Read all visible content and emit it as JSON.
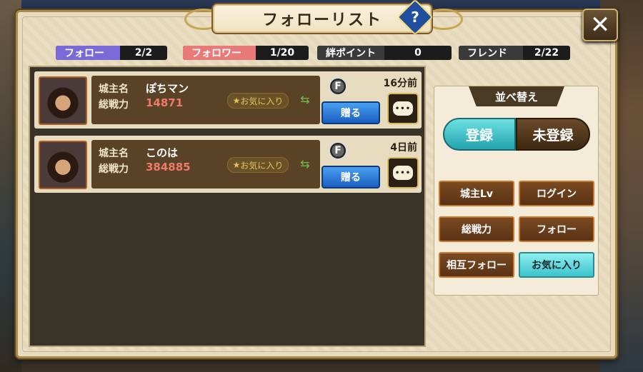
{
  "header": {
    "title": "フォローリスト",
    "help_label": "?",
    "close_label": "✕"
  },
  "stats": [
    {
      "label": "フォロー",
      "value": "2/2",
      "color": "#7a6ad8"
    },
    {
      "label": "フォロワー",
      "value": "1/20",
      "color": "#e87a7a"
    },
    {
      "label": "絆ポイント",
      "value": "0",
      "color": "#3a3a3a"
    },
    {
      "label": "フレンド",
      "value": "2/22",
      "color": "#3a3a3a"
    }
  ],
  "list": {
    "name_label": "城主名",
    "power_label": "総戦力",
    "fav_label": "お気に入り",
    "f_badge": "F",
    "gift_label": "贈る",
    "chat_label": "•••",
    "rows": [
      {
        "name": "ぽちマン",
        "power": "14871",
        "time": "16分前"
      },
      {
        "name": "このは",
        "power": "384885",
        "time": "4日前"
      }
    ]
  },
  "sort": {
    "title": "並べ替え",
    "seg_on": "登録",
    "seg_off": "未登録",
    "buttons": [
      "城主Lv",
      "ログイン",
      "総戦力",
      "フォロー",
      "相互フォロー",
      "お気に入り"
    ]
  },
  "colors": {
    "power_value": "#f07a6a",
    "name_value": "#ffffff",
    "accent_cyan": "#3cc2cc"
  }
}
